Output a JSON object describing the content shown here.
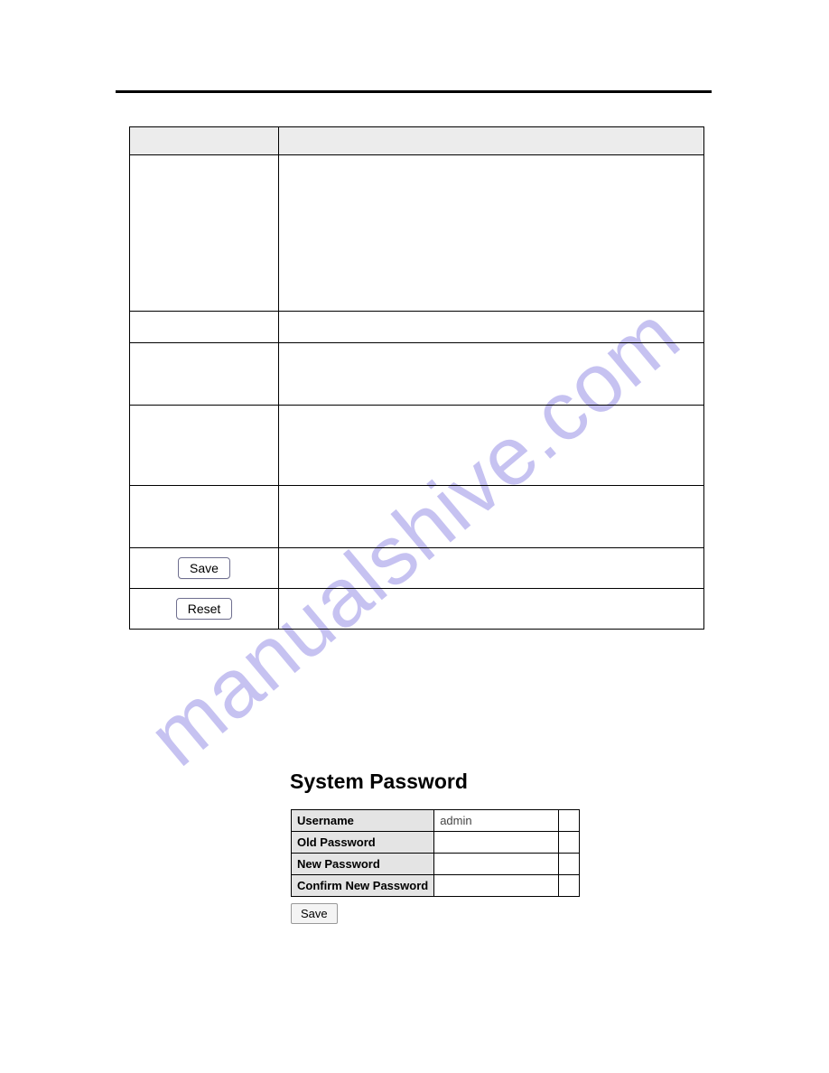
{
  "watermark": "manualshive.com",
  "config": {
    "headers": [
      "",
      ""
    ],
    "rows": {
      "r1": [
        "",
        ""
      ],
      "r2": [
        "",
        ""
      ],
      "r3": [
        "",
        ""
      ],
      "r4": [
        "",
        ""
      ],
      "r5": [
        "",
        ""
      ],
      "r6": {
        "button": "Save",
        "right": ""
      },
      "r7": {
        "button": "Reset",
        "right": ""
      }
    }
  },
  "password": {
    "heading": "System Password",
    "fields": {
      "username_label": "Username",
      "username_value": "admin",
      "old_label": "Old Password",
      "old_value": "",
      "new_label": "New Password",
      "new_value": "",
      "confirm_label": "Confirm New Password",
      "confirm_value": ""
    },
    "save_label": "Save"
  }
}
